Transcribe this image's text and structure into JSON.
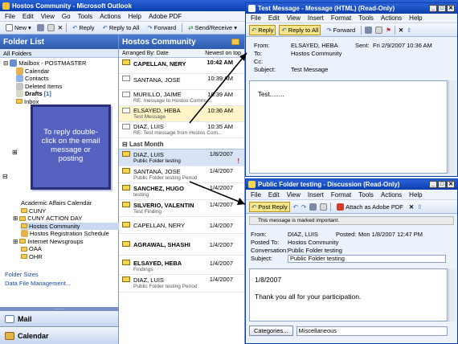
{
  "main": {
    "title": "Hostos Community - Microsoft Outlook",
    "menu": [
      "File",
      "Edit",
      "View",
      "Go",
      "Tools",
      "Actions",
      "Help",
      "Adobe PDF"
    ],
    "toolbar": {
      "new": "New",
      "reply": "Reply",
      "reply_all": "Reply to All",
      "forward": "Forward",
      "send_receive": "Send/Receive"
    }
  },
  "folder_list": {
    "title": "Folder List",
    "all_folders": "All Folders",
    "items": [
      "Mailbox - POSTMASTER",
      "Calendar",
      "Contacts",
      "Deleted Items",
      "Drafts",
      "[1]",
      "Inbox",
      "Academic Affairs Calendar",
      "CUNY",
      "CUNY ACTION DAY",
      "Hostos Community",
      "Hostos Registration Schedule",
      "Internet Newsgroups",
      "OAA",
      "OHR"
    ],
    "links": [
      "Folder Sizes",
      "Data File Management..."
    ]
  },
  "callout": {
    "text": "To reply double-click on the email message or posting"
  },
  "nav": {
    "mail": "Mail",
    "calendar": "Calendar"
  },
  "message_list": {
    "title": "Hostos Community",
    "arranged_by": "Arranged By: Date",
    "sort": "Newest on top",
    "group_last_month": "Last Month",
    "items": [
      {
        "from": "CAPELLAN, NERY",
        "date": "10:42 AM",
        "subject": ""
      },
      {
        "from": "SANTANA, JOSE",
        "date": "10:39 AM",
        "subject": ""
      },
      {
        "from": "MURILLO, JAIME",
        "date": "10:39 AM",
        "subject": "RE: message to Hostos Commu..."
      },
      {
        "from": "ELSAYED, HEBA",
        "date": "10:36 AM",
        "subject": "Test Message"
      },
      {
        "from": "DIAZ, LUIS",
        "date": "10:35 AM",
        "subject": "RE: Test message from Hostos Com..."
      },
      {
        "from": "DIAZ, LUIS",
        "date": "1/8/2007",
        "subject": "Public Folder testing"
      },
      {
        "from": "SANTANA, JOSE",
        "date": "1/4/2007",
        "subject": "Public Folder testing Period"
      },
      {
        "from": "SANCHEZ, HUGO",
        "date": "1/4/2007",
        "subject": "testing"
      },
      {
        "from": "SILVERIO, VALENTIN",
        "date": "1/4/2007",
        "subject": "Test Finding"
      },
      {
        "from": "CAPELLAN, NERY",
        "date": "1/4/2007",
        "subject": ""
      },
      {
        "from": "AGRAWAL, SHASHI",
        "date": "1/4/2007",
        "subject": ""
      },
      {
        "from": "ELSAYED, HEBA",
        "date": "1/4/2007",
        "subject": "Findings"
      },
      {
        "from": "DIAZ, LUIS",
        "date": "1/4/2007",
        "subject": "Public Folder testing Period"
      }
    ]
  },
  "message_window": {
    "title": "Test Message - Message (HTML) (Read-Only)",
    "menu": [
      "File",
      "Edit",
      "View",
      "Insert",
      "Format",
      "Tools",
      "Actions",
      "Help"
    ],
    "toolbar": {
      "reply": "Reply",
      "reply_all": "Reply to All",
      "forward": "Forward"
    },
    "from_label": "From:",
    "from": "ELSAYED, HEBA",
    "sent_label": "Sent:",
    "sent": "Fri 2/9/2007 10:36 AM",
    "to_label": "To:",
    "to": "Hostos Community",
    "cc_label": "Cc:",
    "subject_label": "Subject:",
    "subject": "Test Message",
    "body": "Test........"
  },
  "discussion_window": {
    "title": "Public Folder testing - Discussion (Read-Only)",
    "menu": [
      "File",
      "Edit",
      "View",
      "Insert",
      "Format",
      "Tools",
      "Actions",
      "Help"
    ],
    "toolbar": {
      "post_reply": "Post Reply",
      "attach_pdf": "Attach as Adobe PDF"
    },
    "info_bar": "This message is marked important.",
    "from_label": "From:",
    "from": "DIAZ, LUIS",
    "posted_label": "Posted:",
    "posted": "Mon 1/8/2007 12:47 PM",
    "posted_to_label": "Posted To:",
    "posted_to": "Hostos Community",
    "conversation_label": "Conversation:",
    "conversation": "Public Folder testing",
    "subject_label": "Subject:",
    "subject": "Public Folder testing",
    "body_date": "1/8/2007",
    "body_text": "Thank you all for your participation.",
    "categories_button": "Categories...",
    "categories_value": "Miscellaneous"
  }
}
